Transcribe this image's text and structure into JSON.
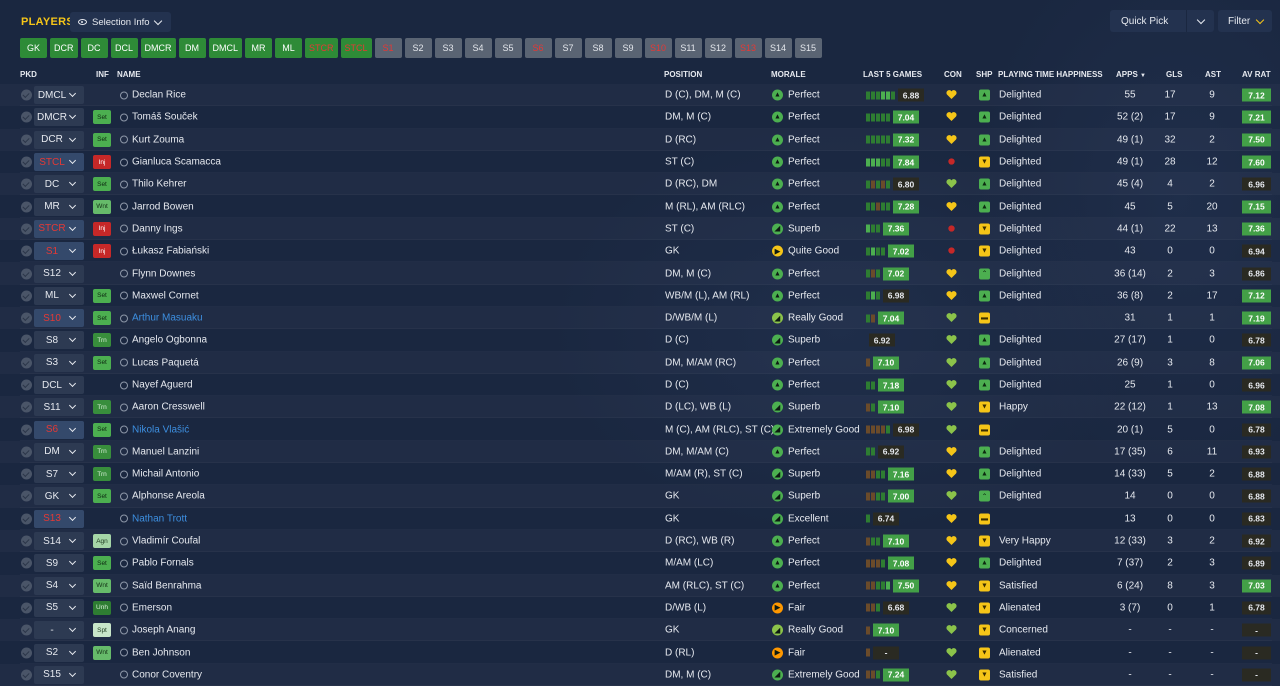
{
  "header": {
    "title": "PLAYERS",
    "selection_info": "Selection Info",
    "quick_pick": "Quick Pick",
    "filter": "Filter"
  },
  "positions": [
    {
      "label": "GK",
      "style": "green"
    },
    {
      "label": "DCR",
      "style": "green"
    },
    {
      "label": "DC",
      "style": "green"
    },
    {
      "label": "DCL",
      "style": "green"
    },
    {
      "label": "DMCR",
      "style": "green"
    },
    {
      "label": "DM",
      "style": "green"
    },
    {
      "label": "DMCL",
      "style": "green"
    },
    {
      "label": "MR",
      "style": "green"
    },
    {
      "label": "ML",
      "style": "green"
    },
    {
      "label": "STCR",
      "style": "green-red"
    },
    {
      "label": "STCL",
      "style": "green-red"
    },
    {
      "label": "S1",
      "style": "grey-red"
    },
    {
      "label": "S2",
      "style": "grey"
    },
    {
      "label": "S3",
      "style": "grey"
    },
    {
      "label": "S4",
      "style": "grey"
    },
    {
      "label": "S5",
      "style": "grey"
    },
    {
      "label": "S6",
      "style": "grey-red"
    },
    {
      "label": "S7",
      "style": "grey"
    },
    {
      "label": "S8",
      "style": "grey"
    },
    {
      "label": "S9",
      "style": "grey"
    },
    {
      "label": "S10",
      "style": "grey-red"
    },
    {
      "label": "S11",
      "style": "grey"
    },
    {
      "label": "S12",
      "style": "grey"
    },
    {
      "label": "S13",
      "style": "grey-red"
    },
    {
      "label": "S14",
      "style": "grey"
    },
    {
      "label": "S15",
      "style": "grey"
    }
  ],
  "columns": {
    "pkd": "PKD",
    "inf": "INF",
    "name": "NAME",
    "position": "POSITION",
    "morale": "MORALE",
    "last5": "LAST 5 GAMES",
    "con": "CON",
    "shp": "SHP",
    "pth": "PLAYING TIME HAPPINESS",
    "apps": "APPS",
    "gls": "GLS",
    "ast": "AST",
    "avrat": "AV RAT"
  },
  "players": [
    {
      "pkd": "DMCL",
      "pkd_red": false,
      "inf": "",
      "name": "Declan Rice",
      "loan": false,
      "pos": "D (C), DM, M (C)",
      "morale": "Perfect",
      "mc": "#4caf50",
      "mi": "▲",
      "bars": "dddggd",
      "l5": "6.88",
      "l5good": false,
      "con": "gold",
      "shp": "up",
      "pth": "Delighted",
      "apps": "55",
      "gls": "17",
      "ast": "9",
      "av": "7.12",
      "avhi": true
    },
    {
      "pkd": "DMCR",
      "pkd_red": false,
      "inf": "Set",
      "name": "Tomáš Souček",
      "loan": false,
      "pos": "DM, M (C)",
      "morale": "Perfect",
      "mc": "#4caf50",
      "mi": "▲",
      "bars": "ddddd",
      "l5": "7.04",
      "l5good": true,
      "con": "gold",
      "shp": "up",
      "pth": "Delighted",
      "apps": "52 (2)",
      "gls": "17",
      "ast": "9",
      "av": "7.21",
      "avhi": true
    },
    {
      "pkd": "DCR",
      "pkd_red": false,
      "inf": "Set",
      "name": "Kurt Zouma",
      "loan": false,
      "pos": "D (RC)",
      "morale": "Perfect",
      "mc": "#4caf50",
      "mi": "▲",
      "bars": "ddddd",
      "l5": "7.32",
      "l5good": true,
      "con": "gold",
      "shp": "up",
      "pth": "Delighted",
      "apps": "49 (1)",
      "gls": "32",
      "ast": "2",
      "av": "7.50",
      "avhi": true
    },
    {
      "pkd": "STCL",
      "pkd_red": true,
      "inf": "Inj",
      "name": "Gianluca Scamacca",
      "loan": false,
      "pos": "ST (C)",
      "morale": "Perfect",
      "mc": "#4caf50",
      "mi": "▲",
      "bars": "gggdd",
      "l5": "7.84",
      "l5good": true,
      "con": "red",
      "shp": "down",
      "pth": "Delighted",
      "apps": "49 (1)",
      "gls": "28",
      "ast": "12",
      "av": "7.60",
      "avhi": true
    },
    {
      "pkd": "DC",
      "pkd_red": false,
      "inf": "Set",
      "name": "Thilo Kehrer",
      "loan": false,
      "pos": "D (RC), DM",
      "morale": "Perfect",
      "mc": "#4caf50",
      "mi": "▲",
      "bars": "dbdbd",
      "l5": "6.80",
      "l5good": false,
      "con": "green",
      "shp": "up",
      "pth": "Delighted",
      "apps": "45 (4)",
      "gls": "4",
      "ast": "2",
      "av": "6.96",
      "avhi": false
    },
    {
      "pkd": "MR",
      "pkd_red": false,
      "inf": "Wnt",
      "name": "Jarrod Bowen",
      "loan": false,
      "pos": "M (RL), AM (RLC)",
      "morale": "Perfect",
      "mc": "#4caf50",
      "mi": "▲",
      "bars": "ddbdd",
      "l5": "7.28",
      "l5good": true,
      "con": "gold",
      "shp": "up",
      "pth": "Delighted",
      "apps": "45",
      "gls": "5",
      "ast": "20",
      "av": "7.15",
      "avhi": true
    },
    {
      "pkd": "STCR",
      "pkd_red": true,
      "inf": "Inj",
      "name": "Danny Ings",
      "loan": false,
      "pos": "ST (C)",
      "morale": "Superb",
      "mc": "#4caf50",
      "mi": "◢",
      "bars": "gdd",
      "l5": "7.36",
      "l5good": true,
      "con": "red",
      "shp": "down",
      "pth": "Delighted",
      "apps": "44 (1)",
      "gls": "22",
      "ast": "13",
      "av": "7.36",
      "avhi": true
    },
    {
      "pkd": "S1",
      "pkd_red": true,
      "inf": "Inj",
      "name": "Łukasz Fabiański",
      "loan": false,
      "pos": "GK",
      "morale": "Quite Good",
      "mc": "#f5c518",
      "mi": "▶",
      "bars": "dgdd",
      "l5": "7.02",
      "l5good": true,
      "con": "red",
      "shp": "down",
      "pth": "Delighted",
      "apps": "43",
      "gls": "0",
      "ast": "0",
      "av": "6.94",
      "avhi": false
    },
    {
      "pkd": "S12",
      "pkd_red": false,
      "inf": "",
      "name": "Flynn Downes",
      "loan": false,
      "pos": "DM, M (C)",
      "morale": "Perfect",
      "mc": "#4caf50",
      "mi": "▲",
      "bars": "dbd",
      "l5": "7.02",
      "l5good": true,
      "con": "gold",
      "shp": "uptri",
      "pth": "Delighted",
      "apps": "36 (14)",
      "gls": "2",
      "ast": "3",
      "av": "6.86",
      "avhi": false
    },
    {
      "pkd": "ML",
      "pkd_red": false,
      "inf": "Set",
      "name": "Maxwel Cornet",
      "loan": false,
      "pos": "WB/M (L), AM (RL)",
      "morale": "Perfect",
      "mc": "#4caf50",
      "mi": "▲",
      "bars": "dgd",
      "l5": "6.98",
      "l5good": false,
      "con": "gold",
      "shp": "up",
      "pth": "Delighted",
      "apps": "36 (8)",
      "gls": "2",
      "ast": "17",
      "av": "7.12",
      "avhi": true
    },
    {
      "pkd": "S10",
      "pkd_red": true,
      "inf": "Set",
      "name": "Arthur Masuaku",
      "loan": true,
      "pos": "D/WB/M (L)",
      "morale": "Really Good",
      "mc": "#8bc34a",
      "mi": "◢",
      "bars": "db",
      "l5": "7.04",
      "l5good": true,
      "con": "green",
      "shp": "flat",
      "pth": "",
      "apps": "31",
      "gls": "1",
      "ast": "1",
      "av": "7.19",
      "avhi": true
    },
    {
      "pkd": "S8",
      "pkd_red": false,
      "inf": "Trn",
      "name": "Angelo Ogbonna",
      "loan": false,
      "pos": "D (C)",
      "morale": "Superb",
      "mc": "#4caf50",
      "mi": "◢",
      "bars": "",
      "l5": "6.92",
      "l5good": false,
      "con": "green",
      "shp": "up",
      "pth": "Delighted",
      "apps": "27 (17)",
      "gls": "1",
      "ast": "0",
      "av": "6.78",
      "avhi": false
    },
    {
      "pkd": "S3",
      "pkd_red": false,
      "inf": "Set",
      "name": "Lucas Paquetá",
      "loan": false,
      "pos": "DM, M/AM (RC)",
      "morale": "Perfect",
      "mc": "#4caf50",
      "mi": "▲",
      "bars": "b",
      "l5": "7.10",
      "l5good": true,
      "con": "green",
      "shp": "up",
      "pth": "Delighted",
      "apps": "26 (9)",
      "gls": "3",
      "ast": "8",
      "av": "7.06",
      "avhi": true
    },
    {
      "pkd": "DCL",
      "pkd_red": false,
      "inf": "",
      "name": "Nayef Aguerd",
      "loan": false,
      "pos": "D (C)",
      "morale": "Perfect",
      "mc": "#4caf50",
      "mi": "▲",
      "bars": "dd",
      "l5": "7.18",
      "l5good": true,
      "con": "green",
      "shp": "up",
      "pth": "Delighted",
      "apps": "25",
      "gls": "1",
      "ast": "0",
      "av": "6.96",
      "avhi": false
    },
    {
      "pkd": "S11",
      "pkd_red": false,
      "inf": "Trn",
      "name": "Aaron Cresswell",
      "loan": false,
      "pos": "D (LC), WB (L)",
      "morale": "Superb",
      "mc": "#4caf50",
      "mi": "◢",
      "bars": "bd",
      "l5": "7.10",
      "l5good": true,
      "con": "green",
      "shp": "down",
      "pth": "Happy",
      "apps": "22 (12)",
      "gls": "1",
      "ast": "13",
      "av": "7.08",
      "avhi": true
    },
    {
      "pkd": "S6",
      "pkd_red": true,
      "inf": "Set",
      "name": "Nikola Vlašić",
      "loan": true,
      "pos": "M (C), AM (RLC), ST (C)",
      "morale": "Extremely Good",
      "mc": "#4caf50",
      "mi": "◢",
      "bars": "bbbbd",
      "l5": "6.98",
      "l5good": false,
      "con": "green",
      "shp": "flat",
      "pth": "",
      "apps": "20 (1)",
      "gls": "5",
      "ast": "0",
      "av": "6.78",
      "avhi": false
    },
    {
      "pkd": "DM",
      "pkd_red": false,
      "inf": "Trn",
      "name": "Manuel Lanzini",
      "loan": false,
      "pos": "DM, M/AM (C)",
      "morale": "Perfect",
      "mc": "#4caf50",
      "mi": "▲",
      "bars": "dd",
      "l5": "6.92",
      "l5good": false,
      "con": "gold",
      "shp": "up",
      "pth": "Delighted",
      "apps": "17 (35)",
      "gls": "6",
      "ast": "11",
      "av": "6.93",
      "avhi": false
    },
    {
      "pkd": "S7",
      "pkd_red": false,
      "inf": "Trn",
      "name": "Michail Antonio",
      "loan": false,
      "pos": "M/AM (R), ST (C)",
      "morale": "Superb",
      "mc": "#4caf50",
      "mi": "◢",
      "bars": "bbdd",
      "l5": "7.16",
      "l5good": true,
      "con": "gold",
      "shp": "up",
      "pth": "Delighted",
      "apps": "14 (33)",
      "gls": "5",
      "ast": "2",
      "av": "6.88",
      "avhi": false
    },
    {
      "pkd": "GK",
      "pkd_red": false,
      "inf": "Set",
      "name": "Alphonse Areola",
      "loan": false,
      "pos": "GK",
      "morale": "Superb",
      "mc": "#4caf50",
      "mi": "◢",
      "bars": "bbdd",
      "l5": "7.00",
      "l5good": true,
      "con": "green",
      "shp": "uptri",
      "pth": "Delighted",
      "apps": "14",
      "gls": "0",
      "ast": "0",
      "av": "6.88",
      "avhi": false
    },
    {
      "pkd": "S13",
      "pkd_red": true,
      "inf": "",
      "name": "Nathan Trott",
      "loan": true,
      "pos": "GK",
      "morale": "Excellent",
      "mc": "#4caf50",
      "mi": "◢",
      "bars": "d",
      "l5": "6.74",
      "l5good": false,
      "con": "gold",
      "shp": "flat",
      "pth": "",
      "apps": "13",
      "gls": "0",
      "ast": "0",
      "av": "6.83",
      "avhi": false
    },
    {
      "pkd": "S14",
      "pkd_red": false,
      "inf": "Agn",
      "name": "Vladimír Coufal",
      "loan": false,
      "pos": "D (RC), WB (R)",
      "morale": "Perfect",
      "mc": "#4caf50",
      "mi": "▲",
      "bars": "bdd",
      "l5": "7.10",
      "l5good": true,
      "con": "gold",
      "shp": "down",
      "pth": "Very Happy",
      "apps": "12 (33)",
      "gls": "3",
      "ast": "2",
      "av": "6.92",
      "avhi": false
    },
    {
      "pkd": "S9",
      "pkd_red": false,
      "inf": "Set",
      "name": "Pablo Fornals",
      "loan": false,
      "pos": "M/AM (LC)",
      "morale": "Perfect",
      "mc": "#4caf50",
      "mi": "▲",
      "bars": "bbbd",
      "l5": "7.08",
      "l5good": true,
      "con": "gold",
      "shp": "up",
      "pth": "Delighted",
      "apps": "7 (37)",
      "gls": "2",
      "ast": "3",
      "av": "6.89",
      "avhi": false
    },
    {
      "pkd": "S4",
      "pkd_red": false,
      "inf": "Wnt",
      "name": "Saïd Benrahma",
      "loan": false,
      "pos": "AM (RLC), ST (C)",
      "morale": "Perfect",
      "mc": "#4caf50",
      "mi": "▲",
      "bars": "bbddg",
      "l5": "7.50",
      "l5good": true,
      "con": "gold",
      "shp": "down",
      "pth": "Satisfied",
      "apps": "6 (24)",
      "gls": "8",
      "ast": "3",
      "av": "7.03",
      "avhi": true
    },
    {
      "pkd": "S5",
      "pkd_red": false,
      "inf": "Unh",
      "name": "Emerson",
      "loan": false,
      "pos": "D/WB (L)",
      "morale": "Fair",
      "mc": "#ff9800",
      "mi": "▶",
      "bars": "bbd",
      "l5": "6.68",
      "l5good": false,
      "con": "green",
      "shp": "down",
      "pth": "Alienated",
      "apps": "3 (7)",
      "gls": "0",
      "ast": "1",
      "av": "6.78",
      "avhi": false
    },
    {
      "pkd": "-",
      "pkd_red": false,
      "inf": "Spt",
      "name": "Joseph Anang",
      "loan": false,
      "pos": "GK",
      "morale": "Really Good",
      "mc": "#8bc34a",
      "mi": "◢",
      "bars": "b",
      "l5": "7.10",
      "l5good": true,
      "con": "green",
      "shp": "down",
      "pth": "Concerned",
      "apps": "-",
      "gls": "-",
      "ast": "-",
      "av": "-",
      "avhi": false
    },
    {
      "pkd": "S2",
      "pkd_red": false,
      "inf": "Wnt",
      "name": "Ben Johnson",
      "loan": false,
      "pos": "D (RL)",
      "morale": "Fair",
      "mc": "#ff9800",
      "mi": "▶",
      "bars": "b",
      "l5": "-",
      "l5good": false,
      "con": "green",
      "shp": "down",
      "pth": "Alienated",
      "apps": "-",
      "gls": "-",
      "ast": "-",
      "av": "-",
      "avhi": false
    },
    {
      "pkd": "S15",
      "pkd_red": false,
      "inf": "",
      "name": "Conor Coventry",
      "loan": false,
      "pos": "DM, M (C)",
      "morale": "Extremely Good",
      "mc": "#4caf50",
      "mi": "◢",
      "bars": "bbd",
      "l5": "7.24",
      "l5good": true,
      "con": "green",
      "shp": "down",
      "pth": "Satisfied",
      "apps": "-",
      "gls": "-",
      "ast": "-",
      "av": "-",
      "avhi": false
    }
  ]
}
